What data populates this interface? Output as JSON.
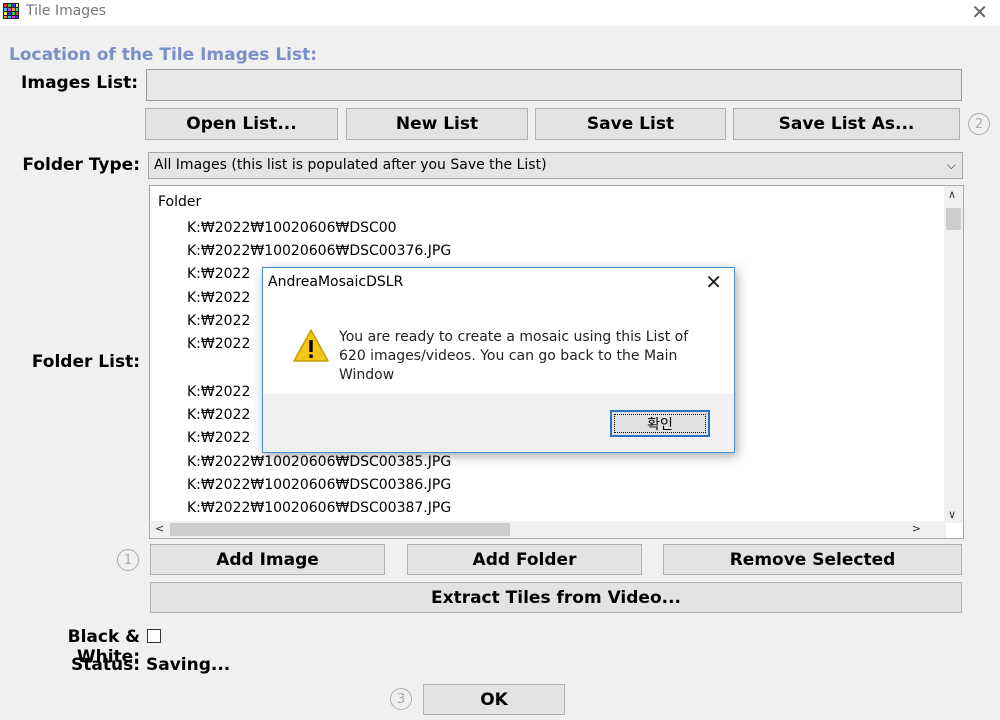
{
  "window": {
    "title": "Tile Images",
    "close_glyph": "✕"
  },
  "section_title": "Location of the Tile Images List:",
  "images_list": {
    "label": "Images List:",
    "value": ""
  },
  "list_buttons": {
    "open": "Open List...",
    "new": "New List",
    "save": "Save List",
    "save_as": "Save List As..."
  },
  "step_numbers": {
    "one": "1",
    "two": "2",
    "three": "3"
  },
  "folder_type": {
    "label": "Folder Type:",
    "selected": "All Images (this list is populated after you Save the List)"
  },
  "folder_list": {
    "label": "Folder List:",
    "header": "Folder",
    "rows": [
      "K:₩2022₩10020606₩DSC00",
      "K:₩2022₩10020606₩DSC00376.JPG",
      "K:₩2022",
      "K:₩2022",
      "K:₩2022",
      "K:₩2022",
      "K:₩2022",
      "K:₩2022",
      "K:₩2022",
      "K:₩2022₩10020606₩DSC00385.JPG",
      "K:₩2022₩10020606₩DSC00386.JPG",
      "K:₩2022₩10020606₩DSC00387.JPG"
    ]
  },
  "action_buttons": {
    "add_image": "Add Image",
    "add_folder": "Add Folder",
    "remove_selected": "Remove Selected",
    "extract_video": "Extract Tiles from Video..."
  },
  "black_white": {
    "label": "Black & White:",
    "checked": false
  },
  "status": {
    "label": "Status:",
    "value": "Saving..."
  },
  "ok_button": "OK",
  "dialog": {
    "title": "AndreaMosaicDSLR",
    "close_glyph": "✕",
    "message": "You are ready to create a mosaic using this List of 620 images/videos. You can go back to the Main Window",
    "confirm": "확인",
    "icon": "warning-icon"
  },
  "colors": {
    "accent_title": "#7b8fc9",
    "dialog_border": "#4a8fd0",
    "warning": "#f5c518"
  }
}
